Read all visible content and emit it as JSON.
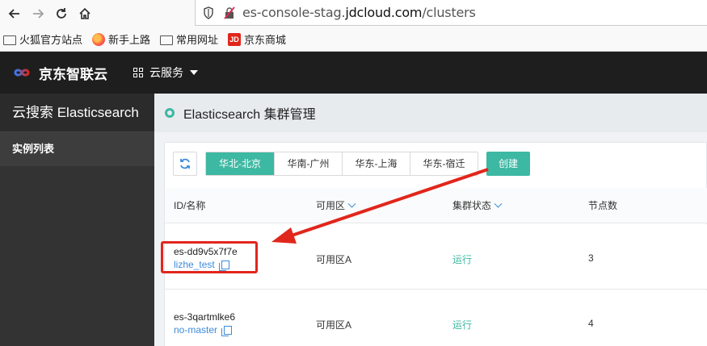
{
  "browser": {
    "url_prefix": "es-console-stag.",
    "url_domain": "jdcloud.com",
    "url_path": "/clusters",
    "bookmarks": [
      {
        "label": "火狐官方站点",
        "icon": "folder-icon"
      },
      {
        "label": "新手上路",
        "icon": "firefox-icon"
      },
      {
        "label": "常用网址",
        "icon": "folder-icon"
      },
      {
        "label": "京东商城",
        "icon": "jd-icon",
        "icon_text": "JD"
      }
    ]
  },
  "header": {
    "brand": "京东智联云",
    "service_menu": "云服务"
  },
  "sidebar": {
    "title": "云搜索 Elasticsearch",
    "items": [
      {
        "label": "实例列表"
      }
    ]
  },
  "page": {
    "title": "Elasticsearch 集群管理"
  },
  "toolbar": {
    "regions": [
      "华北-北京",
      "华南-广州",
      "华东-上海",
      "华东-宿迁"
    ],
    "active_region": "华北-北京",
    "create_label": "创建"
  },
  "table": {
    "columns": [
      "ID/名称",
      "可用区",
      "集群状态",
      "节点数"
    ],
    "rows": [
      {
        "id": "es-dd9v5x7f7e",
        "name": "lizhe_test",
        "zone": "可用区A",
        "status": "运行",
        "nodes": "3"
      },
      {
        "id": "es-3qartmlke6",
        "name": "no-master",
        "zone": "可用区A",
        "status": "运行",
        "nodes": "4"
      }
    ]
  },
  "colors": {
    "accent": "#3db8a2",
    "link": "#3d8bd9",
    "annotation": "#e1261c",
    "header_bg": "#1e1e1e",
    "sidebar_bg": "#333333"
  }
}
